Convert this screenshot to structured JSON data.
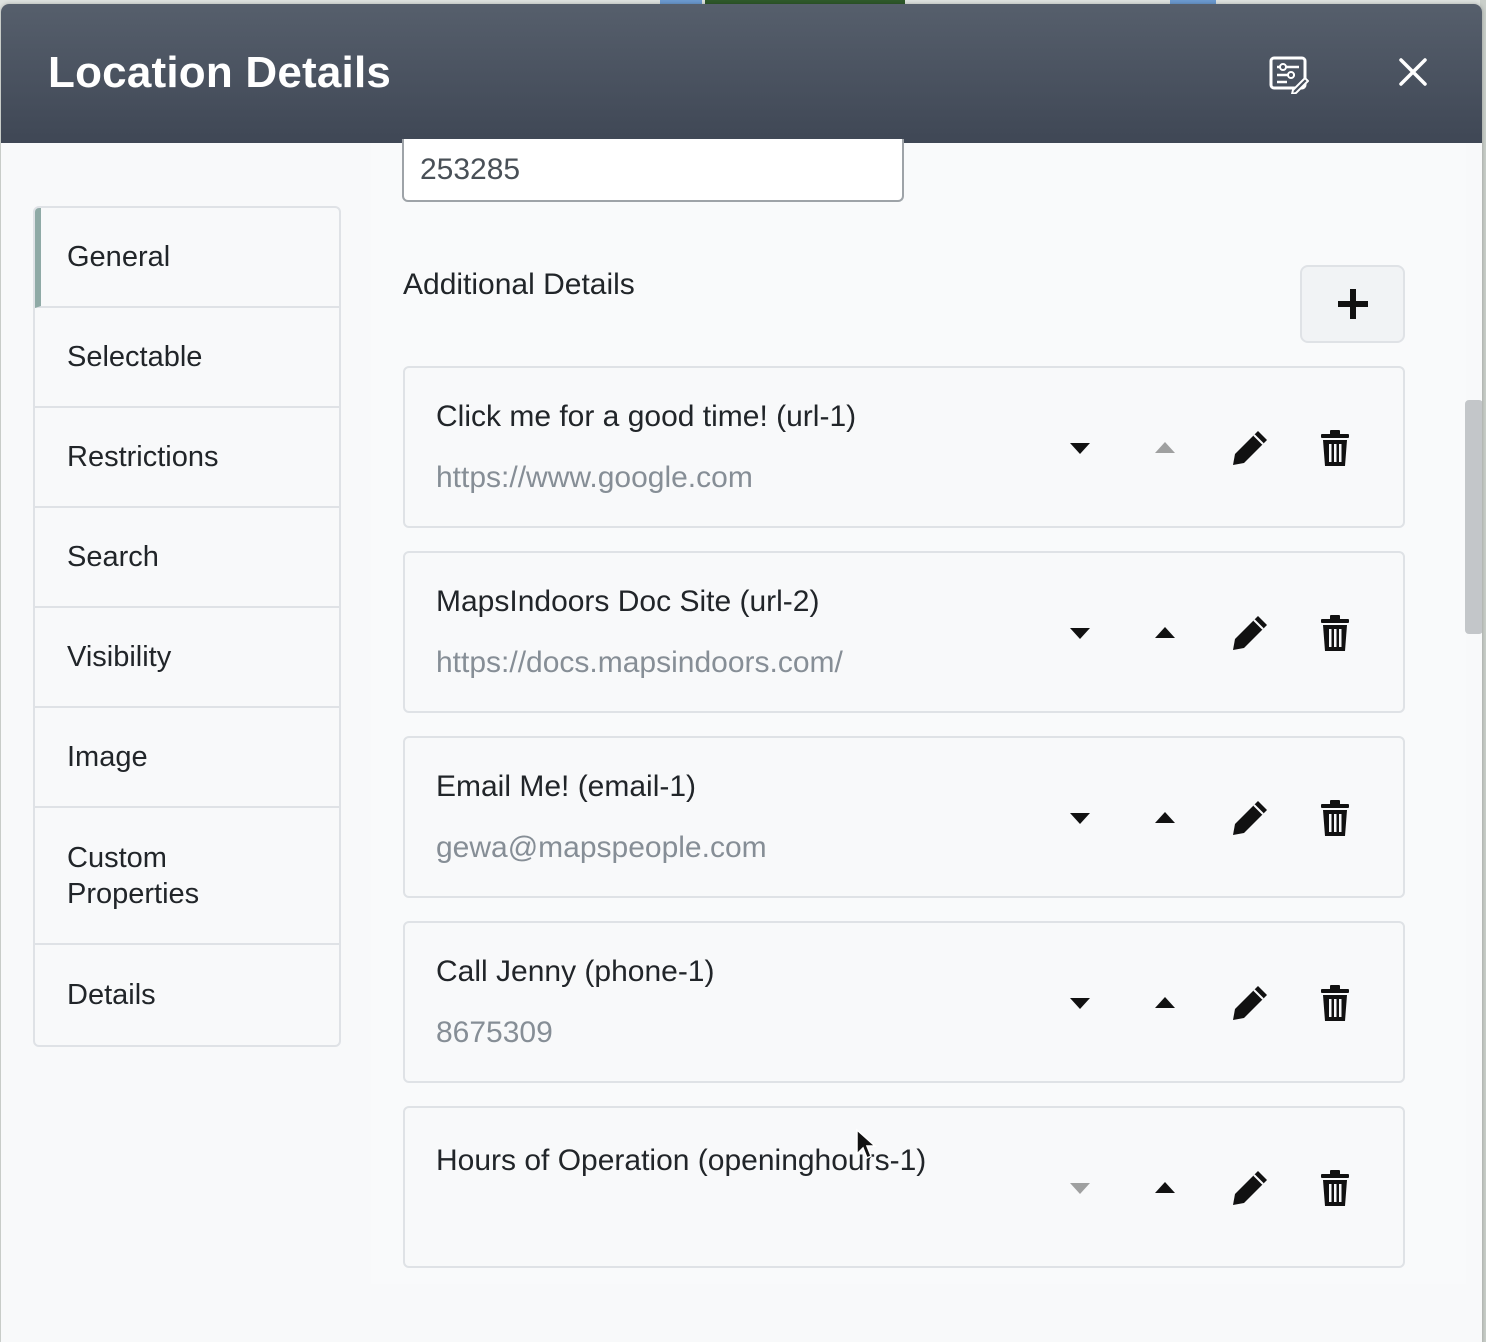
{
  "modal": {
    "title": "Location Details"
  },
  "sidebar": {
    "items": [
      {
        "label": "General",
        "active": true
      },
      {
        "label": "Selectable"
      },
      {
        "label": "Restrictions"
      },
      {
        "label": "Search"
      },
      {
        "label": "Visibility"
      },
      {
        "label": "Image"
      },
      {
        "label": "Custom Properties"
      },
      {
        "label": "Details"
      }
    ]
  },
  "content": {
    "top_input_value": "253285",
    "section_title": "Additional Details",
    "details": [
      {
        "title": "Click me for a good time! (url-1)",
        "value": "https://www.google.com",
        "up_disabled": true,
        "down_disabled": false
      },
      {
        "title": "MapsIndoors Doc Site (url-2)",
        "value": "https://docs.mapsindoors.com/",
        "up_disabled": false,
        "down_disabled": false
      },
      {
        "title": "Email Me! (email-1)",
        "value": "gewa@mapspeople.com",
        "up_disabled": false,
        "down_disabled": false
      },
      {
        "title": "Call Jenny (phone-1)",
        "value": "8675309",
        "up_disabled": false,
        "down_disabled": false
      },
      {
        "title": "Hours of Operation (openinghours-1)",
        "value": "",
        "up_disabled": false,
        "down_disabled": true
      }
    ]
  },
  "icons": {
    "header": [
      "config-icon",
      "close-icon"
    ],
    "add": "plus-icon",
    "card_actions": [
      "caret-down-icon",
      "caret-up-icon",
      "pencil-icon",
      "trash-icon"
    ]
  },
  "colors": {
    "header_top": "#565f6c",
    "header_bottom": "#3f4755",
    "active_indicator": "#8faaa6",
    "value_text": "#868e96"
  }
}
